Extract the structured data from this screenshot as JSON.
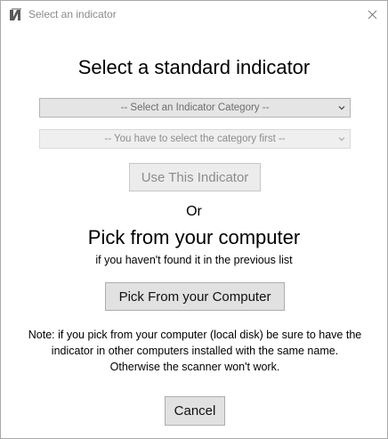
{
  "window": {
    "title": "Select an indicator"
  },
  "standard": {
    "heading": "Select a standard indicator",
    "category_select": {
      "selected": "-- Select an Indicator Category --"
    },
    "indicator_select": {
      "selected": "-- You have to select the category first --"
    },
    "use_button_label": "Use This Indicator"
  },
  "or_text": "Or",
  "computer": {
    "heading": "Pick from your computer",
    "subtext": "if you haven't found it in the previous list",
    "pick_button_label": "Pick From your Computer"
  },
  "note": {
    "line1": "Note: if you pick from your computer (local disk) be sure to have the",
    "line2": "indicator in other computers installed with the same name.",
    "line3": "Otherwise the scanner won't work."
  },
  "footer": {
    "cancel_label": "Cancel"
  },
  "icons": {
    "app": "app-logo-icon",
    "close": "close-icon",
    "dropdown": "chevron-down-icon"
  }
}
